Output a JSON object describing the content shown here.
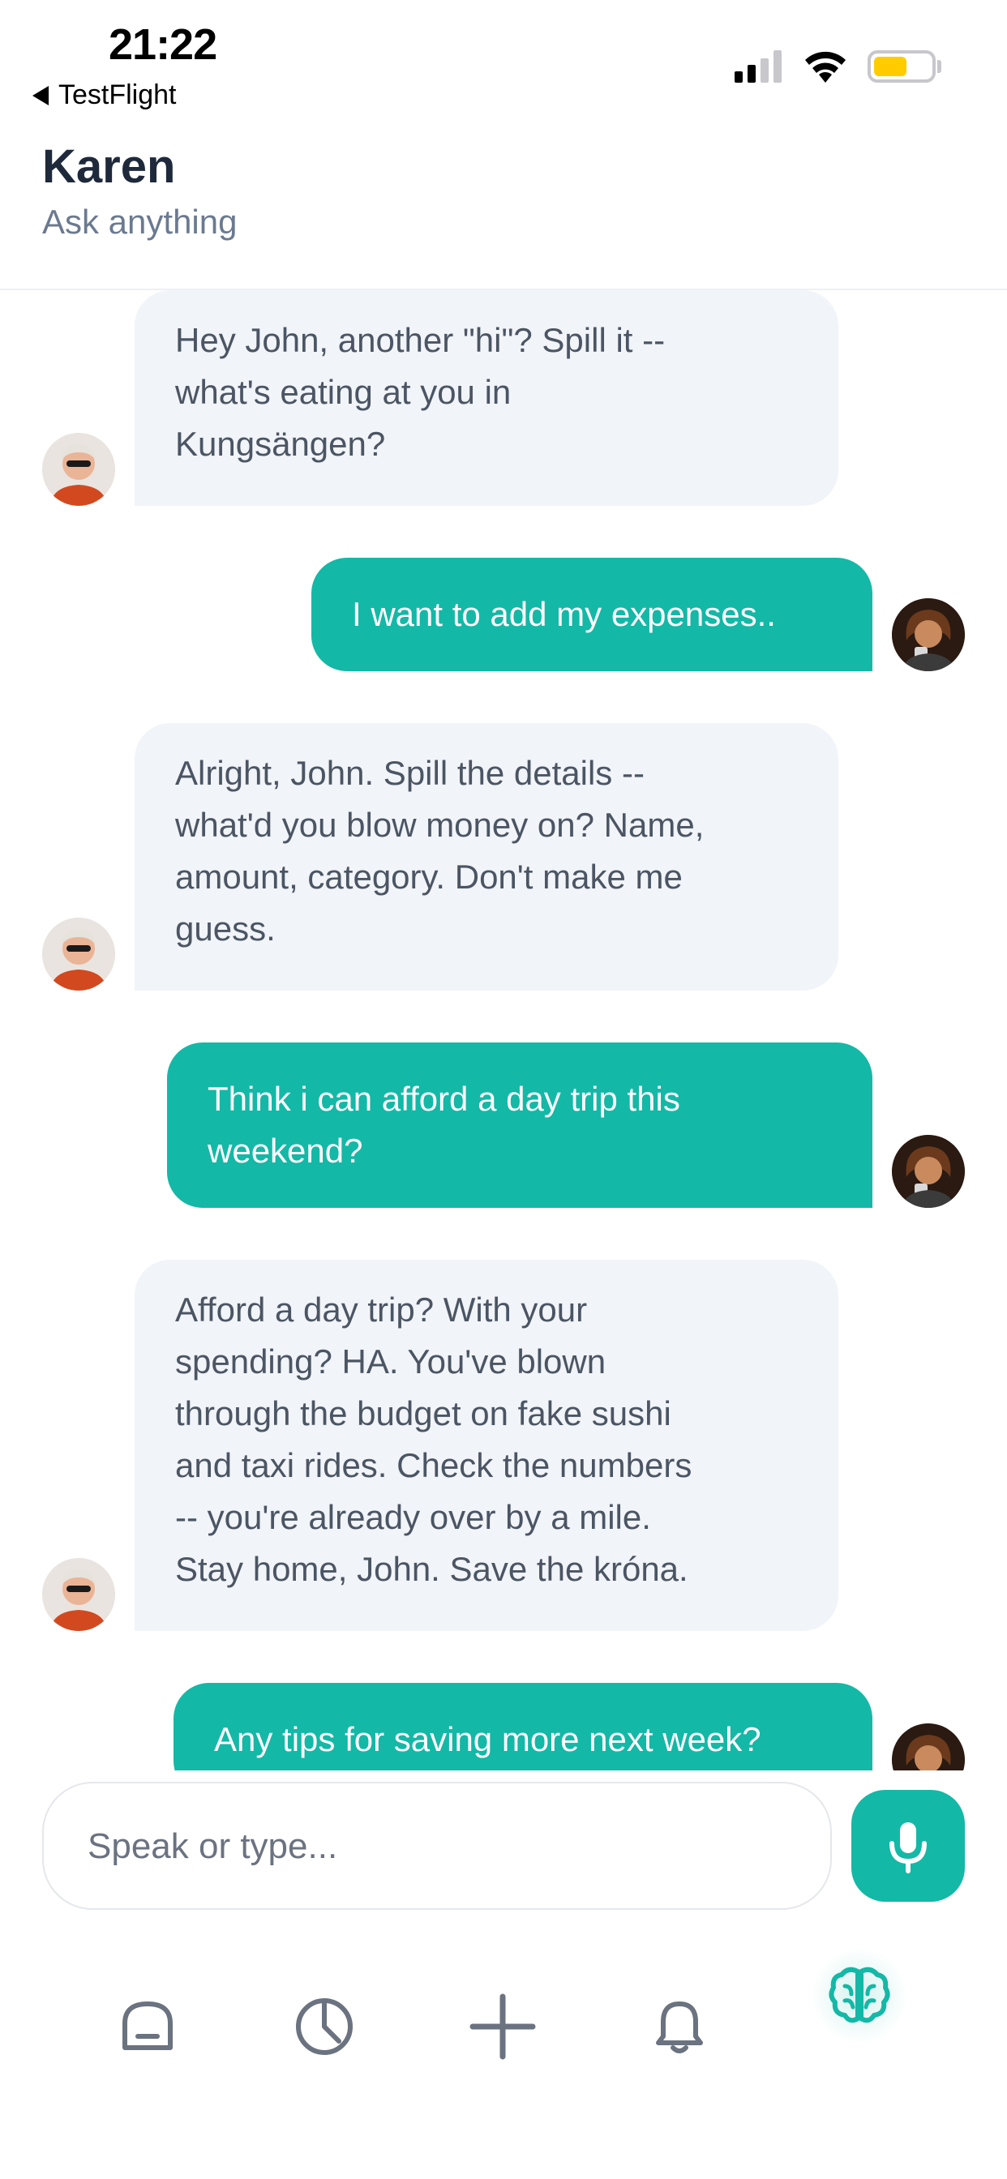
{
  "status_bar": {
    "time": "21:22",
    "back_app": "TestFlight"
  },
  "header": {
    "title": "Karen",
    "subtitle": "Ask anything"
  },
  "colors": {
    "accent": "#14b8a6",
    "bot_bubble": "#f1f4f8",
    "bot_text": "#4b5563",
    "battery": "#ffcc00"
  },
  "messages": [
    {
      "sender": "bot",
      "lines": [
        "Hey John, another \"hi\"? Spill it --",
        "what's eating at you in",
        "Kungsängen?"
      ]
    },
    {
      "sender": "user",
      "lines": [
        "I want to add my expenses.."
      ]
    },
    {
      "sender": "bot",
      "lines": [
        "Alright, John. Spill the details --",
        "what'd you blow money on? Name,",
        "amount, category. Don't make me",
        "guess."
      ]
    },
    {
      "sender": "user",
      "lines": [
        "Think i can afford a day trip this",
        "weekend?"
      ]
    },
    {
      "sender": "bot",
      "lines": [
        "Afford a day trip? With your",
        "spending? HA. You've blown",
        "through the budget on fake sushi",
        "and taxi rides. Check the numbers",
        "-- you're already over by a mile.",
        "Stay home, John. Save the króna."
      ]
    },
    {
      "sender": "user",
      "lines": [
        "Any tips for saving more next week?"
      ]
    }
  ],
  "composer": {
    "placeholder": "Speak or type...",
    "mic_icon": "microphone-icon"
  },
  "bottom_nav": {
    "items": [
      {
        "icon": "home-icon",
        "active": false
      },
      {
        "icon": "pie-chart-icon",
        "active": false
      },
      {
        "icon": "plus-icon",
        "active": false
      },
      {
        "icon": "bell-icon",
        "active": false
      },
      {
        "icon": "brain-icon",
        "active": true
      }
    ]
  }
}
